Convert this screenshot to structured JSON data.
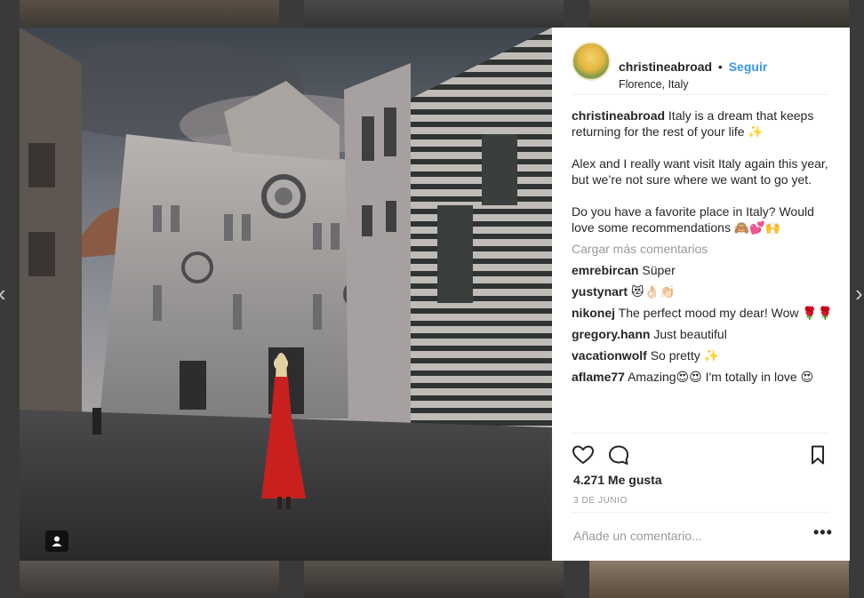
{
  "post": {
    "username": "christineabroad",
    "separator": "•",
    "follow_label": "Seguir",
    "location": "Florence, Italy",
    "caption_paragraphs": [
      "Italy is a dream that keeps returning for the rest of your life ✨",
      "Alex and I really want visit Italy again this year, but we’re not sure where we want to go yet.",
      "Do you have a favorite place in Italy? Would love some recommendations 🙈💕🙌"
    ],
    "load_more_label": "Cargar más comentarios",
    "comments": [
      {
        "user": "emrebircan",
        "text": "Süper"
      },
      {
        "user": "yustynart",
        "text": "😻👌🏻👏🏻"
      },
      {
        "user": "nikonej",
        "text": "The perfect mood my dear! Wow 🌹🌹"
      },
      {
        "user": "gregory.hann",
        "text": "Just beautiful"
      },
      {
        "user": "vacationwolf",
        "text": "So pretty ✨"
      },
      {
        "user": "aflame77",
        "text": "Amazing😍😍 I'm totally in love 😍"
      }
    ],
    "likes_label": "4.271 Me gusta",
    "date_label": "3 DE JUNIO",
    "comment_placeholder": "Añade un comentario...",
    "more_options_glyph": "•••"
  },
  "navigation": {
    "prev_glyph": "‹",
    "next_glyph": "›"
  },
  "icons": [
    "heart-icon",
    "comment-icon",
    "bookmark-icon",
    "user-tag-icon"
  ],
  "colors": {
    "accent": "#3897f0",
    "muted": "#999999",
    "text": "#262626",
    "dress": "#c8201e"
  }
}
